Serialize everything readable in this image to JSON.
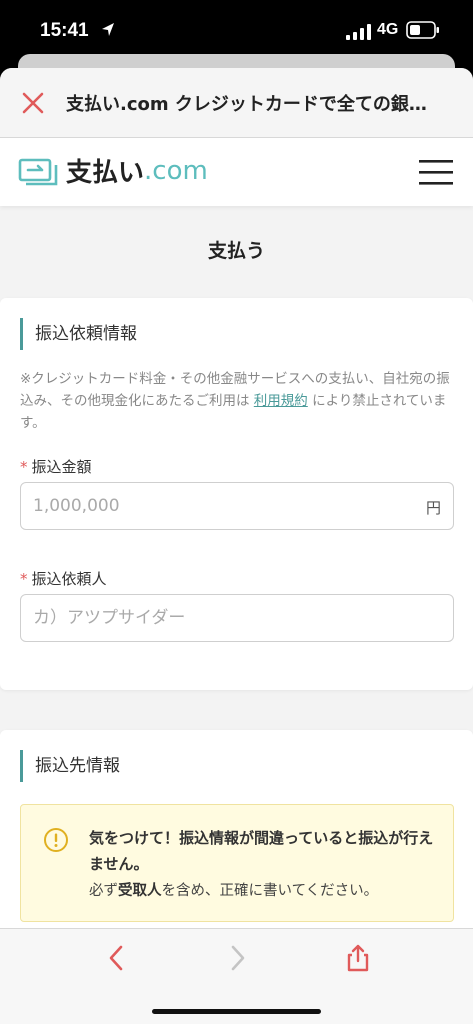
{
  "status_bar": {
    "time": "15:41",
    "network": "4G"
  },
  "browser": {
    "title": "支払い.com クレジットカードで全ての銀…"
  },
  "site": {
    "logo_main": "支払い",
    "logo_suffix": ".com"
  },
  "page": {
    "heading": "支払う"
  },
  "transfer_request": {
    "section_title": "振込依頼情報",
    "notice_prefix": "※クレジットカード料金・その他金融サービスへの支払い、自社宛の振込み、その他現金化にあたるご利用は ",
    "notice_link": "利用規約",
    "notice_suffix": " により禁止されています。",
    "amount": {
      "label": "振込金額",
      "placeholder": "1,000,000",
      "unit": "円"
    },
    "requester": {
      "label": "振込依頼人",
      "placeholder": "カ）アツプサイダー"
    }
  },
  "transfer_dest": {
    "section_title": "振込先情報",
    "warning_strong": "気をつけて！振込情報が間違っていると振込が行えません。",
    "warning_text_pre": "必ず",
    "warning_text_bold": "受取人",
    "warning_text_post": "を含め、正確に書いてください。"
  },
  "colors": {
    "accent": "#4a9a99",
    "required": "#e05a5a",
    "close": "#e05a5a",
    "warning_bg": "#fffbe0"
  }
}
